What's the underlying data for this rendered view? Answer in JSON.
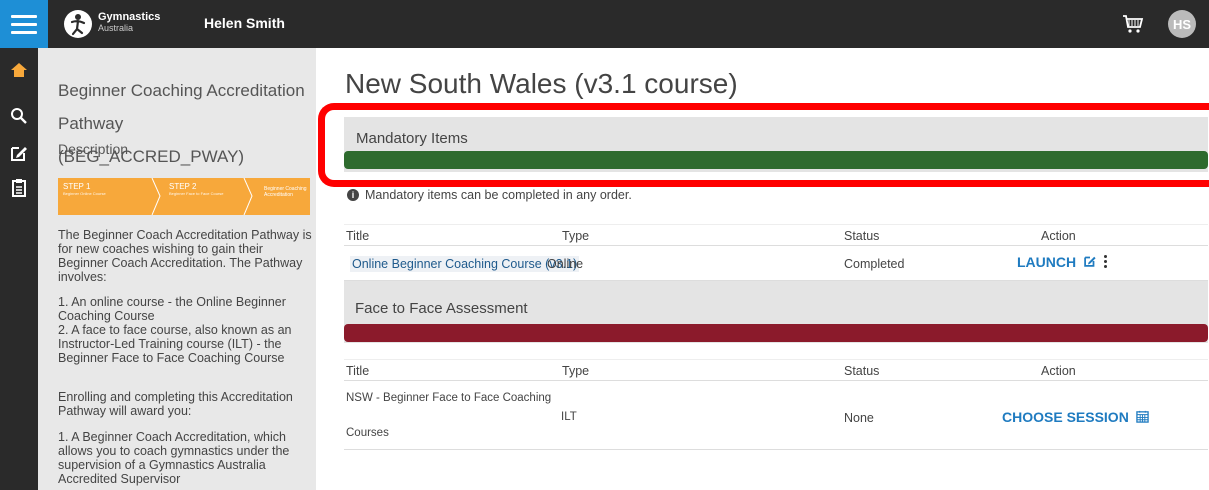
{
  "header": {
    "brand_name": "Gymnastics",
    "brand_sub": "Australia",
    "user_name": "Helen Smith",
    "avatar_initials": "HS"
  },
  "nav": {
    "icons": [
      "home-icon",
      "search-icon",
      "edit-icon",
      "clipboard-icon"
    ],
    "active_color": "#f7a83b",
    "menu_color": "#1e8fd6"
  },
  "sidebar": {
    "title": "Beginner Coaching Accreditation Pathway (BEG_ACCRED_PWAY)",
    "description_label": "Description",
    "steps": [
      {
        "label": "STEP 1",
        "sub": "Beginner Online Course"
      },
      {
        "label": "STEP 2",
        "sub": "Beginner Face to Face Course"
      },
      {
        "label": "Beginner Coaching Accreditation",
        "sub": ""
      }
    ],
    "para1": "The Beginner Coach Accreditation Pathway is for new coaches wishing to gain their Beginner Coach Accreditation. The Pathway involves:",
    "para2": "1. An online course - the Online Beginner Coaching Course\n2. A face to face course, also known as an Instructor-Led Training course (ILT) - the Beginner Face to Face Coaching Course",
    "para3": "Enrolling and completing this Accreditation Pathway will award you:",
    "para4": "1. A Beginner Coach Accreditation, which allows you to coach gymnastics under the supervision of a Gymnastics Australia Accredited Supervisor"
  },
  "main": {
    "page_title": "New South Wales (v3.1 course)",
    "mandatory": {
      "title": "Mandatory Items",
      "bar_color": "#2e6b2e",
      "info_text": "Mandatory items can be completed in any order.",
      "columns": [
        "Title",
        "Type",
        "Status",
        "Action"
      ],
      "rows": [
        {
          "title": "Online Beginner Coaching Course (v3.1)",
          "type": "Online",
          "status": "Completed",
          "action": "LAUNCH"
        }
      ]
    },
    "f2f": {
      "title": "Face to Face Assessment",
      "bar_color": "#8b1a2b",
      "columns": [
        "Title",
        "Type",
        "Status",
        "Action"
      ],
      "rows": [
        {
          "title_line1": "NSW - Beginner Face to Face Coaching",
          "title_line2": "Courses",
          "type": "ILT",
          "status": "None",
          "action": "CHOOSE SESSION"
        }
      ]
    }
  }
}
